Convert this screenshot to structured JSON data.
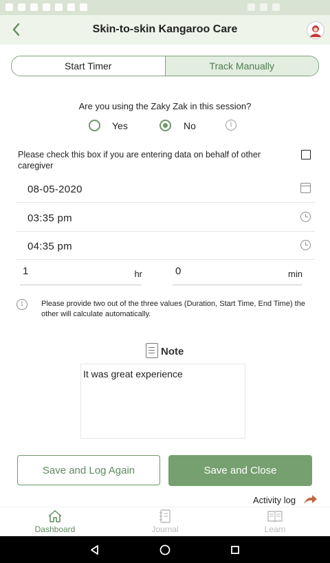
{
  "header": {
    "title": "Skin-to-skin Kangaroo Care"
  },
  "tabs": [
    {
      "label": "Start Timer",
      "active": false
    },
    {
      "label": "Track Manually",
      "active": true
    }
  ],
  "zaky": {
    "question": "Are you using the Zaky Zak in this session?",
    "options": [
      {
        "label": "Yes",
        "selected": false
      },
      {
        "label": "No",
        "selected": true
      }
    ]
  },
  "caregiver": {
    "text": "Please check this box if you are entering data on behalf of other caregiver",
    "checked": false
  },
  "fields": {
    "date": "08-05-2020",
    "start_time": "03:35 pm",
    "end_time": "04:35 pm"
  },
  "duration": {
    "hours": "1",
    "hours_unit": "hr",
    "minutes": "0",
    "minutes_unit": "min"
  },
  "hint": "Please provide two out of the three values (Duration, Start Time, End Time) the other will calculate automatically.",
  "note": {
    "label": "Note",
    "text": "It was great experience"
  },
  "buttons": {
    "save_log_again": "Save and Log Again",
    "save_close": "Save and Close"
  },
  "activity_log": "Activity log",
  "bottom_nav": [
    {
      "label": "Dashboard",
      "icon": "home-icon",
      "active": true
    },
    {
      "label": "Journal",
      "icon": "journal-icon",
      "active": false
    },
    {
      "label": "Learn",
      "icon": "book-icon",
      "active": false
    }
  ],
  "colors": {
    "accent": "#76a06f",
    "accent_dark": "#5f8a5f",
    "header_bg": "#eef4ea",
    "arrow": "#c0653f"
  }
}
